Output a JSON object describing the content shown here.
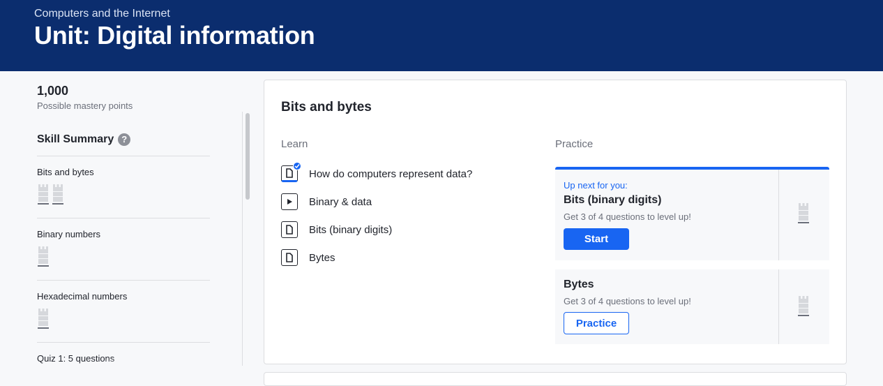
{
  "header": {
    "breadcrumb": "Computers and the Internet",
    "title": "Unit: Digital information",
    "background_color": "#0b2d6e"
  },
  "sidebar": {
    "mastery_points": "1,000",
    "mastery_points_label": "Possible mastery points",
    "skill_summary_title": "Skill Summary",
    "help_icon": "help-circle-icon",
    "skills": [
      {
        "name": "Bits and bytes",
        "mastery_icon_count": 2
      },
      {
        "name": "Binary numbers",
        "mastery_icon_count": 1
      },
      {
        "name": "Hexadecimal numbers",
        "mastery_icon_count": 1
      },
      {
        "name": "Quiz 1: 5 questions",
        "mastery_icon_count": 0
      }
    ]
  },
  "lesson_card": {
    "title": "Bits and bytes",
    "learn_label": "Learn",
    "practice_label": "Practice",
    "learn_items": [
      {
        "label": "How do computers represent data?",
        "icon": "article-icon",
        "completed": true
      },
      {
        "label": "Binary & data",
        "icon": "video-play-icon",
        "completed": false
      },
      {
        "label": "Bits (binary digits)",
        "icon": "article-icon",
        "completed": false
      },
      {
        "label": "Bytes",
        "icon": "article-icon",
        "completed": false
      }
    ],
    "practice_items": [
      {
        "up_next_label": "Up next for you:",
        "title": "Bits (binary digits)",
        "subtitle": "Get 3 of 4 questions to level up!",
        "button_label": "Start"
      },
      {
        "title": "Bytes",
        "subtitle": "Get 3 of 4 questions to level up!",
        "button_label": "Practice"
      }
    ]
  },
  "colors": {
    "accent": "#1865f2",
    "text": "#21242c",
    "muted": "#6b6f7a"
  }
}
